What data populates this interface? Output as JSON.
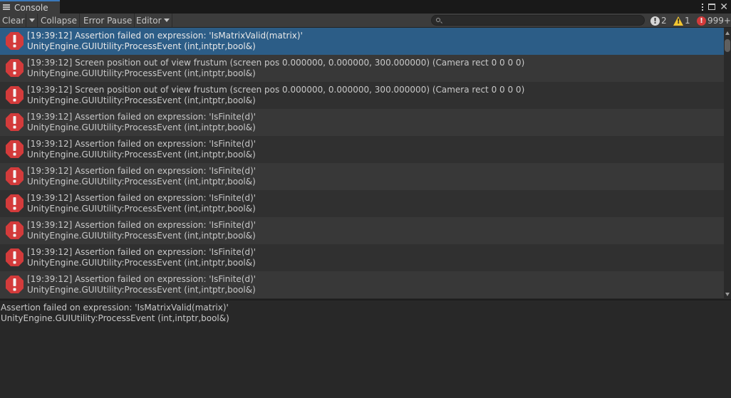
{
  "window": {
    "tab_title": "Console",
    "tab_icon": "console-list-icon"
  },
  "toolbar": {
    "clear_label": "Clear",
    "collapse_label": "Collapse",
    "error_pause_label": "Error Pause",
    "editor_label": "Editor",
    "search_placeholder": "",
    "info_count": "2",
    "warning_count": "1",
    "error_count": "999+"
  },
  "colors": {
    "selected_row": "#2c5d87",
    "error_icon": "#d33b3b",
    "warning_icon": "#f3c631"
  },
  "log": {
    "entries": [
      {
        "line1": "[19:39:12] Assertion failed on expression: 'IsMatrixValid(matrix)'",
        "line2": "UnityEngine.GUIUtility:ProcessEvent (int,intptr,bool&)",
        "selected": true
      },
      {
        "line1": "[19:39:12] Screen position out of view frustum (screen pos 0.000000, 0.000000, 300.000000) (Camera rect 0 0 0 0)",
        "line2": "UnityEngine.GUIUtility:ProcessEvent (int,intptr,bool&)"
      },
      {
        "line1": "[19:39:12] Screen position out of view frustum (screen pos 0.000000, 0.000000, 300.000000) (Camera rect 0 0 0 0)",
        "line2": "UnityEngine.GUIUtility:ProcessEvent (int,intptr,bool&)"
      },
      {
        "line1": "[19:39:12] Assertion failed on expression: 'IsFinite(d)'",
        "line2": "UnityEngine.GUIUtility:ProcessEvent (int,intptr,bool&)"
      },
      {
        "line1": "[19:39:12] Assertion failed on expression: 'IsFinite(d)'",
        "line2": "UnityEngine.GUIUtility:ProcessEvent (int,intptr,bool&)"
      },
      {
        "line1": "[19:39:12] Assertion failed on expression: 'IsFinite(d)'",
        "line2": "UnityEngine.GUIUtility:ProcessEvent (int,intptr,bool&)"
      },
      {
        "line1": "[19:39:12] Assertion failed on expression: 'IsFinite(d)'",
        "line2": "UnityEngine.GUIUtility:ProcessEvent (int,intptr,bool&)"
      },
      {
        "line1": "[19:39:12] Assertion failed on expression: 'IsFinite(d)'",
        "line2": "UnityEngine.GUIUtility:ProcessEvent (int,intptr,bool&)"
      },
      {
        "line1": "[19:39:12] Assertion failed on expression: 'IsFinite(d)'",
        "line2": "UnityEngine.GUIUtility:ProcessEvent (int,intptr,bool&)"
      },
      {
        "line1": "[19:39:12] Assertion failed on expression: 'IsFinite(d)'",
        "line2": "UnityEngine.GUIUtility:ProcessEvent (int,intptr,bool&)"
      }
    ]
  },
  "detail": {
    "line1": "Assertion failed on expression: 'IsMatrixValid(matrix)'",
    "line2": "UnityEngine.GUIUtility:ProcessEvent (int,intptr,bool&)"
  }
}
